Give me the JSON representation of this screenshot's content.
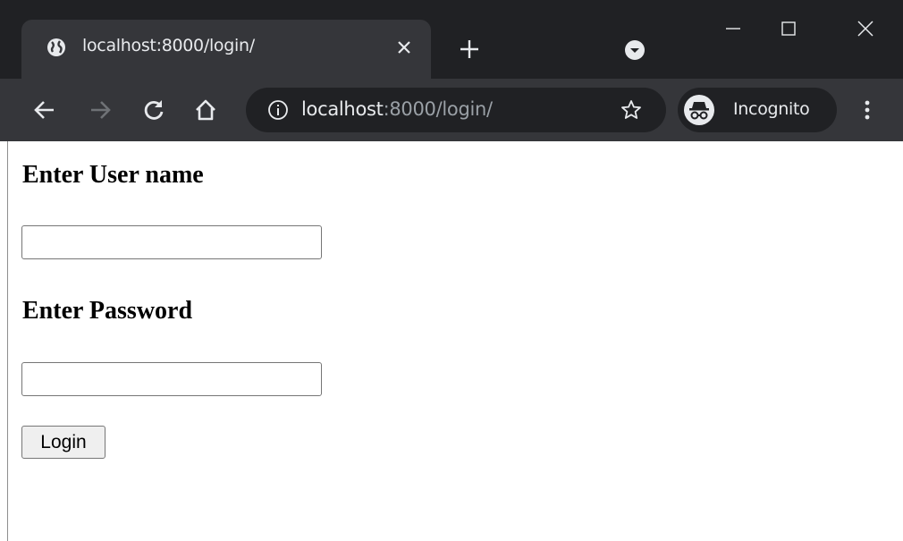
{
  "browser": {
    "tab": {
      "title": "localhost:8000/login/"
    },
    "omnibox": {
      "host": "localhost",
      "path": ":8000/login/"
    },
    "incognito_label": "Incognito"
  },
  "page": {
    "username_label": "Enter User name",
    "username_value": "",
    "password_label": "Enter Password",
    "password_value": "",
    "login_button_label": "Login"
  },
  "icons": {
    "favicon": "globe-icon",
    "tab_close": "close-icon",
    "new_tab": "plus-icon",
    "tab_search": "chevron-down-icon",
    "back": "arrow-left-icon",
    "forward": "arrow-right-icon",
    "reload": "reload-icon",
    "home": "home-icon",
    "site_info": "info-icon",
    "bookmark": "star-icon",
    "incognito": "incognito-icon",
    "menu": "kebab-menu-icon"
  },
  "colors": {
    "titlebar": "#202124",
    "toolbar": "#35363a",
    "chrome_text": "#e8eaed",
    "url_muted": "#9aa0a6",
    "page_background": "#ffffff"
  }
}
